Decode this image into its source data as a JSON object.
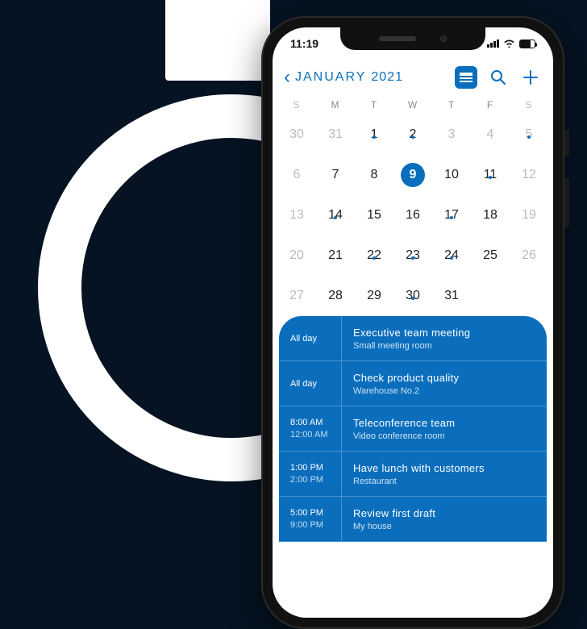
{
  "status": {
    "time": "11:19"
  },
  "nav": {
    "month": "JANUARY",
    "year": "2021"
  },
  "weekdays": [
    "S",
    "M",
    "T",
    "W",
    "T",
    "F",
    "S"
  ],
  "calendar": [
    [
      {
        "d": "30",
        "muted": true,
        "dot": false,
        "sel": false
      },
      {
        "d": "31",
        "muted": true,
        "dot": false,
        "sel": false
      },
      {
        "d": "1",
        "muted": false,
        "dot": true,
        "sel": false
      },
      {
        "d": "2",
        "muted": false,
        "dot": true,
        "sel": false
      },
      {
        "d": "3",
        "muted": true,
        "dot": false,
        "sel": false
      },
      {
        "d": "4",
        "muted": true,
        "dot": false,
        "sel": false
      },
      {
        "d": "5",
        "muted": true,
        "dot": true,
        "sel": false
      }
    ],
    [
      {
        "d": "6",
        "muted": true,
        "dot": false,
        "sel": false
      },
      {
        "d": "7",
        "muted": false,
        "dot": false,
        "sel": false
      },
      {
        "d": "8",
        "muted": false,
        "dot": false,
        "sel": false
      },
      {
        "d": "9",
        "muted": false,
        "dot": false,
        "sel": true
      },
      {
        "d": "10",
        "muted": false,
        "dot": false,
        "sel": false
      },
      {
        "d": "11",
        "muted": false,
        "dot": true,
        "sel": false
      },
      {
        "d": "12",
        "muted": true,
        "dot": false,
        "sel": false
      }
    ],
    [
      {
        "d": "13",
        "muted": true,
        "dot": false,
        "sel": false
      },
      {
        "d": "14",
        "muted": false,
        "dot": true,
        "sel": false
      },
      {
        "d": "15",
        "muted": false,
        "dot": false,
        "sel": false
      },
      {
        "d": "16",
        "muted": false,
        "dot": false,
        "sel": false
      },
      {
        "d": "17",
        "muted": false,
        "dot": true,
        "sel": false
      },
      {
        "d": "18",
        "muted": false,
        "dot": false,
        "sel": false
      },
      {
        "d": "19",
        "muted": true,
        "dot": false,
        "sel": false
      }
    ],
    [
      {
        "d": "20",
        "muted": true,
        "dot": false,
        "sel": false
      },
      {
        "d": "21",
        "muted": false,
        "dot": false,
        "sel": false
      },
      {
        "d": "22",
        "muted": false,
        "dot": true,
        "sel": false
      },
      {
        "d": "23",
        "muted": false,
        "dot": true,
        "sel": false
      },
      {
        "d": "24",
        "muted": false,
        "dot": true,
        "sel": false
      },
      {
        "d": "25",
        "muted": false,
        "dot": false,
        "sel": false
      },
      {
        "d": "26",
        "muted": true,
        "dot": false,
        "sel": false
      }
    ],
    [
      {
        "d": "27",
        "muted": true,
        "dot": false,
        "sel": false
      },
      {
        "d": "28",
        "muted": false,
        "dot": false,
        "sel": false
      },
      {
        "d": "29",
        "muted": false,
        "dot": false,
        "sel": false
      },
      {
        "d": "30",
        "muted": false,
        "dot": true,
        "sel": false
      },
      {
        "d": "31",
        "muted": false,
        "dot": false,
        "sel": false
      },
      {
        "d": "",
        "muted": true,
        "dot": false,
        "sel": false
      },
      {
        "d": "",
        "muted": true,
        "dot": false,
        "sel": false
      }
    ]
  ],
  "events": [
    {
      "time1": "All day",
      "time2": "",
      "title": "Executive team meeting",
      "loc": "Small meeting room"
    },
    {
      "time1": "All day",
      "time2": "",
      "title": "Check product quality",
      "loc": "Warehouse  No.2"
    },
    {
      "time1": "8:00 AM",
      "time2": "12:00 AM",
      "title": "Teleconference team",
      "loc": "Video conference room"
    },
    {
      "time1": "1:00 PM",
      "time2": "2:00 PM",
      "title": "Have lunch with customers",
      "loc": "Restaurant"
    },
    {
      "time1": "5:00 PM",
      "time2": "9:00 PM",
      "title": "Review first draft",
      "loc": "My house"
    }
  ]
}
